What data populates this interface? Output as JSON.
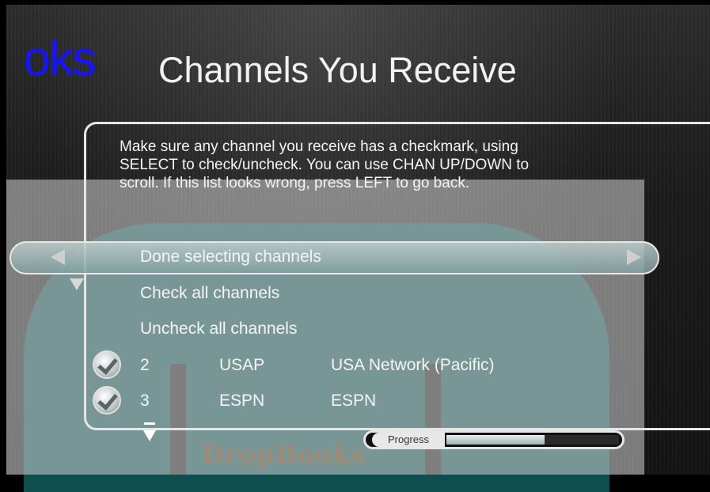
{
  "brand": {
    "text": "oks"
  },
  "header": {
    "title": "Channels You Receive"
  },
  "instructions": [
    "Make sure any channel you receive has a checkmark, using",
    "SELECT to check/uncheck. You can use CHAN UP/DOWN to",
    "scroll. If this list looks wrong, press LEFT to go back."
  ],
  "menu": {
    "items": [
      {
        "label": "Done selecting channels",
        "selected": true
      },
      {
        "label": "Check all channels"
      },
      {
        "label": "Uncheck all channels"
      }
    ]
  },
  "channels": [
    {
      "checked": true,
      "number": "2",
      "callsign": "USAP",
      "name": "USA Network (Pacific)"
    },
    {
      "checked": true,
      "number": "3",
      "callsign": "ESPN",
      "name": "ESPN"
    }
  ],
  "progress": {
    "label": "Progress",
    "fraction": 0.57
  },
  "watermark": {
    "text": "DropBooks"
  },
  "colors": {
    "brand": "#1414ff",
    "overlay_teal": "#0f4e50",
    "highlight": "#a8bcbc"
  },
  "icons": [
    "left-arrow-icon",
    "right-arrow-icon",
    "down-arrow-icon",
    "scroll-down-icon",
    "checkmark-icon"
  ]
}
